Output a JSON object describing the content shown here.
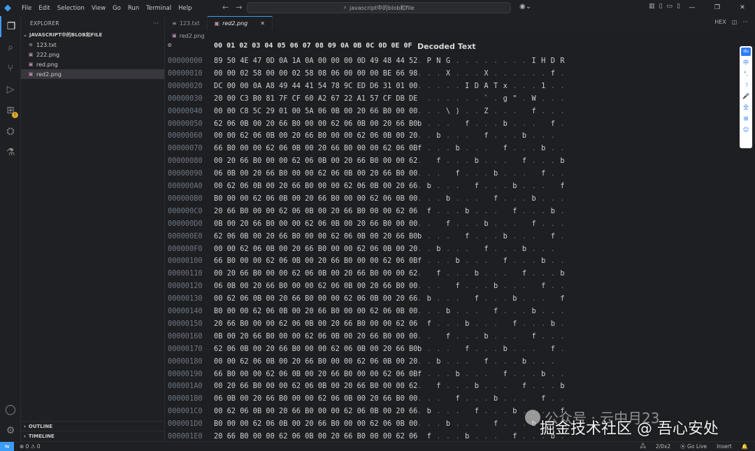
{
  "menu": [
    "File",
    "Edit",
    "Selection",
    "View",
    "Go",
    "Run",
    "Terminal",
    "Help"
  ],
  "command_center": "javascript中的blob和file",
  "sidebar": {
    "title": "EXPLORER",
    "more": "···",
    "section": "JAVASCRIPT中的BLOB和FILE",
    "files": [
      {
        "name": "123.txt",
        "icon": "≡"
      },
      {
        "name": "222.png",
        "icon": "▣"
      },
      {
        "name": "red.png",
        "icon": "▣"
      },
      {
        "name": "red2.png",
        "icon": "▣"
      }
    ],
    "outline": "OUTLINE",
    "timeline": "TIMELINE"
  },
  "tabs": [
    {
      "name": "123.txt",
      "icon": "≡"
    },
    {
      "name": "red2.png",
      "icon": "▣",
      "close": "✕"
    }
  ],
  "breadcrumb": "red2.png",
  "hex": {
    "columns": [
      "00",
      "01",
      "02",
      "03",
      "04",
      "05",
      "06",
      "07",
      "08",
      "09",
      "0A",
      "0B",
      "0C",
      "0D",
      "0E",
      "0F"
    ],
    "decoded_title": "Decoded Text",
    "rows": [
      {
        "addr": "00000000",
        "bytes": "89 50 4E 47 0D 0A 1A 0A 00 00 00 0D 49 48 44 52",
        "text": ". P N G . . . . . . . . I H D R"
      },
      {
        "addr": "00000010",
        "bytes": "00 00 02 58 00 00 02 58 08 06 00 00 00 BE 66 98",
        "text": ". . . X . . . X . . . . . . f ."
      },
      {
        "addr": "00000020",
        "bytes": "DC 00 00 0A A8 49 44 41 54 78 9C ED D6 31 01 00",
        "text": ". . . . . I D A T x . . . 1 . ."
      },
      {
        "addr": "00000030",
        "bytes": "20 00 C3 B0 81 7F CF 60 A2 67 22 A1 57 CF DB DE",
        "text": "  . . . . . . ` . g \" . W . . ."
      },
      {
        "addr": "00000040",
        "bytes": "00 00 C8 5C 29 01 00 5A 06 0B 00 20 66 B0 00 00",
        "text": ". . . \\ ) . . Z . . .   f . . ."
      },
      {
        "addr": "00000050",
        "bytes": "62 06 0B 00 20 66 B0 00 00 62 06 0B 00 20 66 B0",
        "text": "b . . .   f . . . b . . .   f ."
      },
      {
        "addr": "00000060",
        "bytes": "00 00 62 06 0B 00 20 66 B0 00 00 62 06 0B 00 20",
        "text": ". . b . . .   f . . . b . . .  "
      },
      {
        "addr": "00000070",
        "bytes": "66 B0 00 00 62 06 0B 00 20 66 B0 00 00 62 06 0B",
        "text": "f . . . b . . .   f . . . b . ."
      },
      {
        "addr": "00000080",
        "bytes": "00 20 66 B0 00 00 62 06 0B 00 20 66 B0 00 00 62",
        "text": ".   f . . . b . . .   f . . . b"
      },
      {
        "addr": "00000090",
        "bytes": "06 0B 00 20 66 B0 00 00 62 06 0B 00 20 66 B0 00",
        "text": ". . .   f . . . b . . .   f . ."
      },
      {
        "addr": "000000A0",
        "bytes": "00 62 06 0B 00 20 66 B0 00 00 62 06 0B 00 20 66",
        "text": ". b . . .   f . . . b . . .   f"
      },
      {
        "addr": "000000B0",
        "bytes": "B0 00 00 62 06 0B 00 20 66 B0 00 00 62 06 0B 00",
        "text": ". . . b . . .   f . . . b . . ."
      },
      {
        "addr": "000000C0",
        "bytes": "20 66 B0 00 00 62 06 0B 00 20 66 B0 00 00 62 06",
        "text": "  f . . . b . . .   f . . . b ."
      },
      {
        "addr": "000000D0",
        "bytes": "0B 00 20 66 B0 00 00 62 06 0B 00 20 66 B0 00 00",
        "text": ". .   f . . . b . . .   f . . ."
      },
      {
        "addr": "000000E0",
        "bytes": "62 06 0B 00 20 66 B0 00 00 62 06 0B 00 20 66 B0",
        "text": "b . . .   f . . . b . . .   f ."
      },
      {
        "addr": "000000F0",
        "bytes": "00 00 62 06 0B 00 20 66 B0 00 00 62 06 0B 00 20",
        "text": ". . b . . .   f . . . b . . .  "
      },
      {
        "addr": "00000100",
        "bytes": "66 B0 00 00 62 06 0B 00 20 66 B0 00 00 62 06 0B",
        "text": "f . . . b . . .   f . . . b . ."
      },
      {
        "addr": "00000110",
        "bytes": "00 20 66 B0 00 00 62 06 0B 00 20 66 B0 00 00 62",
        "text": ".   f . . . b . . .   f . . . b"
      },
      {
        "addr": "00000120",
        "bytes": "06 0B 00 20 66 B0 00 00 62 06 0B 00 20 66 B0 00",
        "text": ". . .   f . . . b . . .   f . ."
      },
      {
        "addr": "00000130",
        "bytes": "00 62 06 0B 00 20 66 B0 00 00 62 06 0B 00 20 66",
        "text": ". b . . .   f . . . b . . .   f"
      },
      {
        "addr": "00000140",
        "bytes": "B0 00 00 62 06 0B 00 20 66 B0 00 00 62 06 0B 00",
        "text": ". . . b . . .   f . . . b . . ."
      },
      {
        "addr": "00000150",
        "bytes": "20 66 B0 00 00 62 06 0B 00 20 66 B0 00 00 62 06",
        "text": "  f . . . b . . .   f . . . b ."
      },
      {
        "addr": "00000160",
        "bytes": "0B 00 20 66 B0 00 00 62 06 0B 00 20 66 B0 00 00",
        "text": ". .   f . . . b . . .   f . . ."
      },
      {
        "addr": "00000170",
        "bytes": "62 06 0B 00 20 66 B0 00 00 62 06 0B 00 20 66 B0",
        "text": "b . . .   f . . . b . . .   f ."
      },
      {
        "addr": "00000180",
        "bytes": "00 00 62 06 0B 00 20 66 B0 00 00 62 06 0B 00 20",
        "text": ". . b . . .   f . . . b . . .  "
      },
      {
        "addr": "00000190",
        "bytes": "66 B0 00 00 62 06 0B 00 20 66 B0 00 00 62 06 0B",
        "text": "f . . . b . . .   f . . . b . ."
      },
      {
        "addr": "000001A0",
        "bytes": "00 20 66 B0 00 00 62 06 0B 00 20 66 B0 00 00 62",
        "text": ".   f . . . b . . .   f . . . b"
      },
      {
        "addr": "000001B0",
        "bytes": "06 0B 00 20 66 B0 00 00 62 06 0B 00 20 66 B0 00",
        "text": ". . .   f . . . b . . .   f . ."
      },
      {
        "addr": "000001C0",
        "bytes": "00 62 06 0B 00 20 66 B0 00 00 62 06 0B 00 20 66",
        "text": ". b . . .   f . . . b . . .   f"
      },
      {
        "addr": "000001D0",
        "bytes": "B0 00 00 62 06 0B 00 20 66 B0 00 00 62 06 0B 00",
        "text": ". . . b . . .   f . . . b . . ."
      },
      {
        "addr": "000001E0",
        "bytes": "20 66 B0 00 00 62 06 0B 00 20 66 B0 00 00 62 06",
        "text": "  f . . . b . . .   f . . . b ."
      }
    ]
  },
  "ime": [
    "du",
    "中",
    "°,",
    "☽",
    "🎤",
    "全",
    "⊞",
    "☺"
  ],
  "watermark": {
    "line1": "公众号 · 云中月23",
    "line2": "掘金技术社区 @ 吾心安处"
  },
  "status": {
    "remote": "⇋",
    "problems": "⊗ 0  ⚠ 0",
    "bell_and_account": "🖧",
    "position": "2/0x2",
    "go_live": "⦿ Go Live",
    "mode": "Insert"
  },
  "colors": {
    "accent": "#3b9cf5",
    "background": "#1e1f22"
  }
}
